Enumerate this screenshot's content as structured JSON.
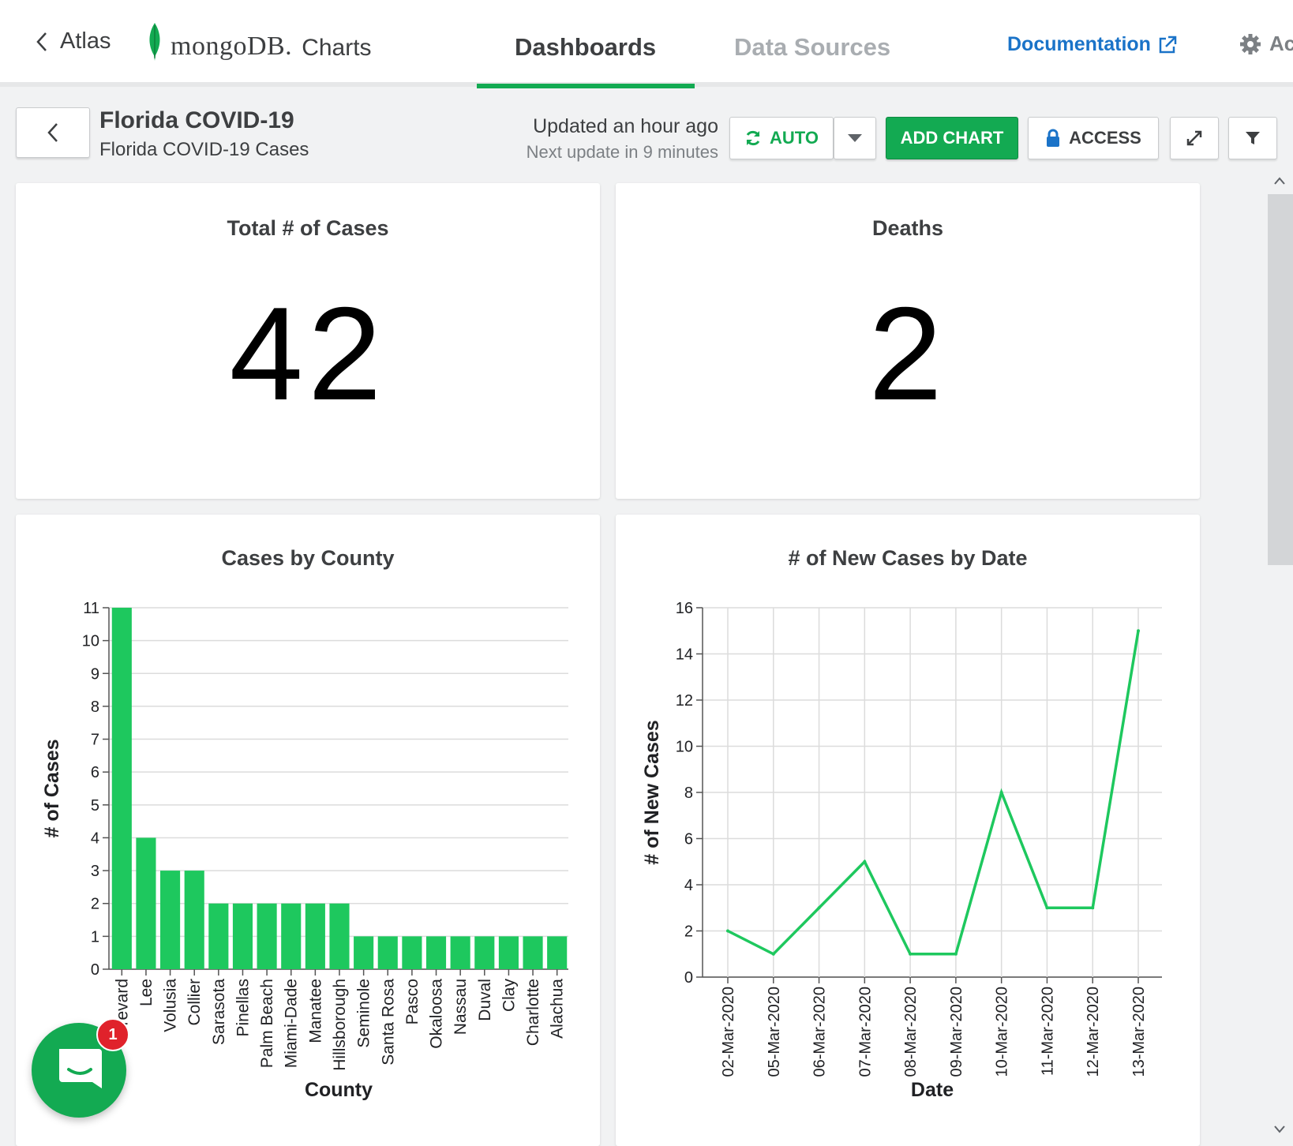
{
  "nav": {
    "back_label": "Atlas",
    "brand_mongo": "mongoDB.",
    "brand_charts": "Charts",
    "tabs": [
      "Dashboards",
      "Data Sources"
    ],
    "active_tab": "Dashboards",
    "documentation": "Documentation",
    "account": "Ac"
  },
  "dashboard": {
    "title": "Florida COVID-19",
    "subtitle": "Florida COVID-19 Cases",
    "updated": "Updated an hour ago",
    "next_update": "Next update in 9 minutes",
    "auto_label": "AUTO",
    "add_chart_label": "ADD CHART",
    "access_label": "ACCESS"
  },
  "colors": {
    "accent": "#13aa52",
    "link": "#1a73c8",
    "line": "#1ec85e"
  },
  "icons": [
    "chevron-left-icon",
    "mongodb-leaf-icon",
    "external-link-icon",
    "gear-icon",
    "refresh-icon",
    "caret-down-icon",
    "lock-icon",
    "expand-icon",
    "filter-icon",
    "chat-icon"
  ],
  "cards": {
    "total": {
      "title": "Total # of Cases",
      "value": "42"
    },
    "deaths": {
      "title": "Deaths",
      "value": "2"
    }
  },
  "intercom": {
    "badge": "1"
  },
  "chart_data": [
    {
      "type": "bar",
      "title": "Cases by County",
      "xlabel": "County",
      "ylabel": "# of Cases",
      "ylim": [
        0,
        11
      ],
      "yticks": [
        "0",
        "1",
        "2",
        "3",
        "4",
        "5",
        "6",
        "7",
        "8",
        "9",
        "10",
        "11"
      ],
      "grid": true,
      "categories": [
        "Brevard",
        "Lee",
        "Volusia",
        "Collier",
        "Sarasota",
        "Pinellas",
        "Palm Beach",
        "Miami-Dade",
        "Manatee",
        "Hillsborough",
        "Seminole",
        "Santa Rosa",
        "Pasco",
        "Okaloosa",
        "Nassau",
        "Duval",
        "Clay",
        "Charlotte",
        "Alachua"
      ],
      "values": [
        11,
        4,
        3,
        3,
        2,
        2,
        2,
        2,
        2,
        2,
        1,
        1,
        1,
        1,
        1,
        1,
        1,
        1,
        1
      ]
    },
    {
      "type": "line",
      "title": "# of New Cases by Date",
      "xlabel": "Date",
      "ylabel": "# of New Cases",
      "ylim": [
        0,
        16
      ],
      "yticks": [
        "0",
        "2",
        "4",
        "6",
        "8",
        "10",
        "12",
        "14",
        "16"
      ],
      "grid": true,
      "x": [
        "02-Mar-2020",
        "05-Mar-2020",
        "06-Mar-2020",
        "07-Mar-2020",
        "08-Mar-2020",
        "09-Mar-2020",
        "10-Mar-2020",
        "11-Mar-2020",
        "12-Mar-2020",
        "13-Mar-2020"
      ],
      "values": [
        2,
        1,
        3,
        5,
        1,
        1,
        8,
        3,
        3,
        15
      ]
    }
  ]
}
